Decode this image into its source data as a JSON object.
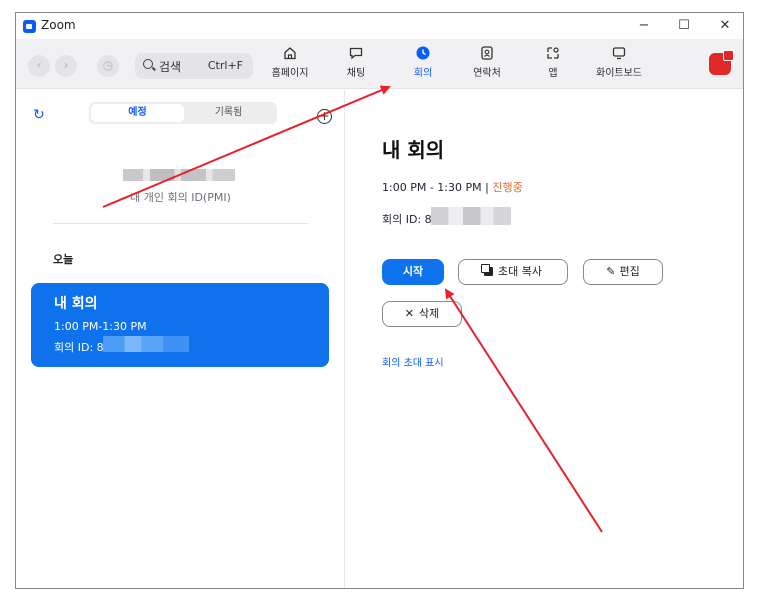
{
  "window": {
    "title": "Zoom"
  },
  "window_controls": {
    "minimize": "−",
    "maximize": "☐",
    "close": "✕"
  },
  "toolbar": {
    "search": {
      "label": "검색",
      "shortcut": "Ctrl+F"
    },
    "nav": [
      {
        "label": "홈페이지",
        "icon": "home-icon"
      },
      {
        "label": "채팅",
        "icon": "chat-icon"
      },
      {
        "label": "회의",
        "icon": "clock-icon",
        "active": true
      },
      {
        "label": "연락처",
        "icon": "contacts-icon"
      },
      {
        "label": "앱",
        "icon": "apps-icon"
      },
      {
        "label": "화이트보드",
        "icon": "whiteboard-icon"
      }
    ]
  },
  "left": {
    "tabs": {
      "scheduled": "예정",
      "recorded": "기록됨"
    },
    "pmi_label": "내 개인 회의 ID(PMI)",
    "section_today": "오늘",
    "meeting_card": {
      "title": "내 회의",
      "time": "1:00 PM-1:30 PM",
      "id_prefix": "회의 ID: 8"
    }
  },
  "right": {
    "title": "내 회의",
    "time": "1:00 PM - 1:30 PM",
    "separator": "|",
    "status": "진행중",
    "id_prefix": "회의 ID: 8",
    "buttons": {
      "start": "시작",
      "copy_invite": "초대 복사",
      "edit": "편집",
      "delete": "삭제"
    },
    "show_invite": "회의 초대 표시"
  },
  "colors": {
    "accent": "#0b5cff",
    "card_blue": "#0e72ed",
    "status_orange": "#e7662a",
    "annotation_red": "#e8202a"
  }
}
